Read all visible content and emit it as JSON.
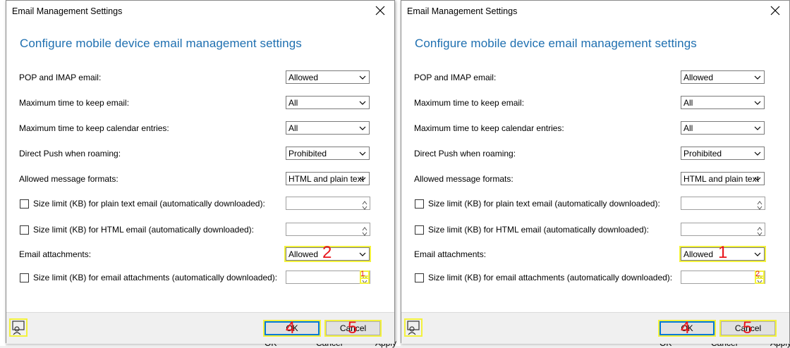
{
  "background": {
    "buttons": [
      "OK",
      "Cancel",
      "Apply"
    ]
  },
  "dialogs": [
    {
      "title": "Email Management Settings",
      "heading": "Configure mobile device email management settings",
      "fields": [
        {
          "label": "POP and IMAP email:",
          "value": "Allowed"
        },
        {
          "label": "Maximum time to keep email:",
          "value": "All"
        },
        {
          "label": "Maximum time to keep calendar entries:",
          "value": "All"
        },
        {
          "label": "Direct Push when roaming:",
          "value": "Prohibited"
        },
        {
          "label": "Allowed message formats:",
          "value": "HTML and plain text"
        }
      ],
      "size_limits": [
        {
          "label": "Size limit (KB) for plain text email (automatically downloaded):",
          "value": ""
        },
        {
          "label": "Size limit (KB) for HTML email (automatically downloaded):",
          "value": ""
        }
      ],
      "attachments": {
        "label": "Email attachments:",
        "value": "Allowed",
        "marker": "2"
      },
      "attachment_limit": {
        "label": "Size limit (KB) for email attachments (automatically downloaded):",
        "value": "",
        "marker": "1"
      },
      "buttons": {
        "ok": "OK",
        "cancel": "Cancel",
        "ok_marker": "4",
        "cancel_marker": "5"
      }
    },
    {
      "title": "Email Management Settings",
      "heading": "Configure mobile device email management settings",
      "fields": [
        {
          "label": "POP and IMAP email:",
          "value": "Allowed"
        },
        {
          "label": "Maximum time to keep email:",
          "value": "All"
        },
        {
          "label": "Maximum time to keep calendar entries:",
          "value": "All"
        },
        {
          "label": "Direct Push when roaming:",
          "value": "Prohibited"
        },
        {
          "label": "Allowed message formats:",
          "value": "HTML and plain text"
        }
      ],
      "size_limits": [
        {
          "label": "Size limit (KB) for plain text email (automatically downloaded):",
          "value": ""
        },
        {
          "label": "Size limit (KB) for HTML email (automatically downloaded):",
          "value": ""
        }
      ],
      "attachments": {
        "label": "Email attachments:",
        "value": "Allowed",
        "marker": "1"
      },
      "attachment_limit": {
        "label": "Size limit (KB) for email attachments (automatically downloaded):",
        "value": "",
        "marker": "2"
      },
      "buttons": {
        "ok": "OK",
        "cancel": "Cancel",
        "ok_marker": "4",
        "cancel_marker": "5"
      }
    }
  ],
  "colors": {
    "heading": "#1e6fb0",
    "highlight": "#f3f23c",
    "marker": "#e8141b",
    "default_button_border": "#0078d7"
  },
  "icons": {
    "close": "close-icon",
    "chevron": "chevron-down-icon",
    "help": "help-icon",
    "spin_up": "spin-up-icon",
    "spin_down": "spin-down-icon"
  }
}
